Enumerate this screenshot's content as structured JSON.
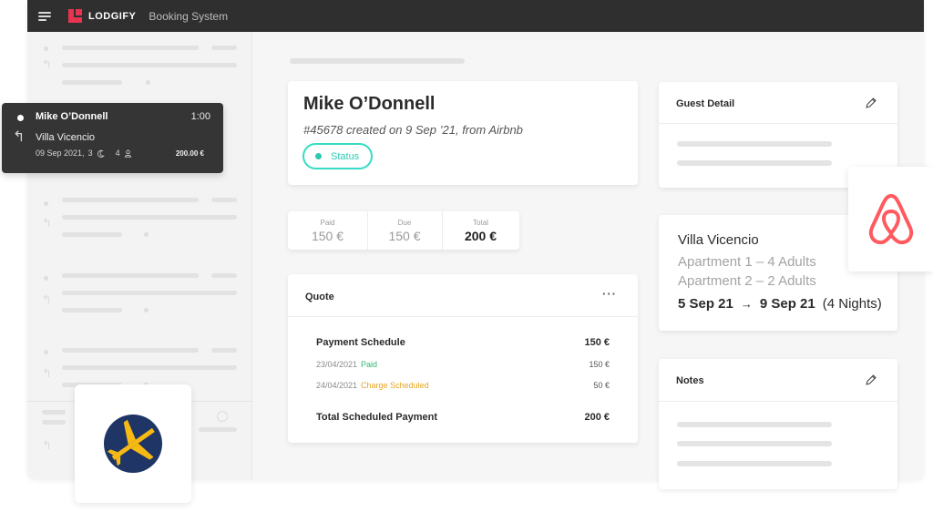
{
  "app": {
    "brand": "LODGIFY",
    "subtitle": "Booking System"
  },
  "tooltip": {
    "guest": "Mike O’Donnell",
    "time": "1:00",
    "property": "Villa Vicencio",
    "date": "09 Sep 2021,",
    "nights": "3",
    "guests": "4",
    "price": "200.00 €"
  },
  "booking": {
    "guest_name": "Mike O’Donnell",
    "reference": "#45678 created on 9 Sep ’21, from Airbnb",
    "status_label": "Status"
  },
  "payments": {
    "paid_label": "Paid",
    "paid_value": "150 €",
    "due_label": "Due",
    "due_value": "150 €",
    "total_label": "Total",
    "total_value": "200 €"
  },
  "quote": {
    "title": "Quote",
    "more": "···",
    "schedule_label": "Payment Schedule",
    "schedule_amount": "150 €",
    "rows": [
      {
        "date": "23/04/2021",
        "status": "Paid",
        "amount": "150 €"
      },
      {
        "date": "24/04/2021",
        "status": "Charge Scheduled",
        "amount": "50 €"
      }
    ],
    "total_label": "Total Scheduled Payment",
    "total_amount": "200 €"
  },
  "guest_detail": {
    "title": "Guest Detail"
  },
  "stay": {
    "property": "Villa Vicencio",
    "apartments": [
      "Apartment 1 – 4 Adults",
      "Apartment 2 – 2 Adults"
    ],
    "check_in": "5 Sep 21",
    "arrow": "→",
    "check_out": "9 Sep 21",
    "nights": "(4 Nights)"
  },
  "notes": {
    "title": "Notes"
  },
  "colors": {
    "brand": "#e8344e",
    "status": "#36dcc3",
    "paid": "#2eb872",
    "scheduled": "#e8a520",
    "airbnb": "#ff5a5f",
    "expedia_bg": "#1e3565",
    "expedia_plane": "#f7b913"
  },
  "icons": {
    "menu": "hamburger-icon",
    "edit": "pencil-icon",
    "reply": "reply-arrow-icon",
    "moon": "moon-icon",
    "person": "person-icon",
    "airbnb": "airbnb-logo",
    "expedia": "expedia-logo"
  }
}
